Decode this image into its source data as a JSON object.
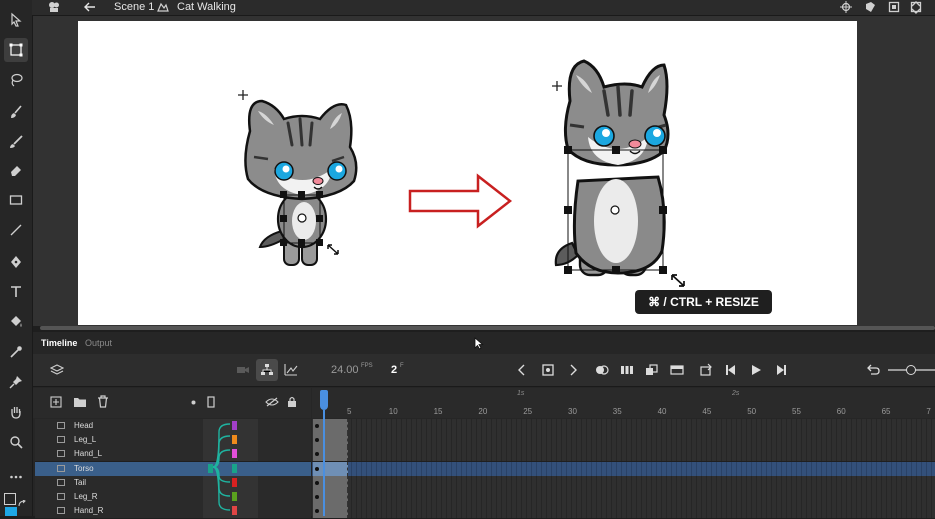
{
  "header": {
    "scene_label": "Scene 1",
    "symbol_label": "Cat Walking"
  },
  "tooltip": {
    "text": "⌘ / CTRL + RESIZE"
  },
  "timeline": {
    "tab_timeline": "Timeline",
    "tab_output": "Output",
    "fps_value": "24.00",
    "fps_unit": "FPS",
    "frame_value": "2",
    "frame_unit": "F",
    "ruler_seconds": [
      "1s",
      "2s"
    ],
    "ruler_frames": [
      "5",
      "10",
      "15",
      "20",
      "25",
      "30",
      "35",
      "40",
      "45",
      "50",
      "55",
      "60",
      "65",
      "7"
    ],
    "layers": [
      {
        "name": "Head",
        "color": "#a33fc9",
        "selected": false
      },
      {
        "name": "Leg_L",
        "color": "#f08a1c",
        "selected": false
      },
      {
        "name": "Hand_L",
        "color": "#e24fd9",
        "selected": false
      },
      {
        "name": "Torso",
        "color": "#19a38a",
        "selected": true
      },
      {
        "name": "Tail",
        "color": "#d92121",
        "selected": false
      },
      {
        "name": "Leg_R",
        "color": "#5aa11e",
        "selected": false
      },
      {
        "name": "Hand_R",
        "color": "#e04545",
        "selected": false
      }
    ]
  },
  "colors": {
    "selection": "#3a5f8a",
    "playhead": "#4a8fe0",
    "arrow": "#c82020"
  }
}
